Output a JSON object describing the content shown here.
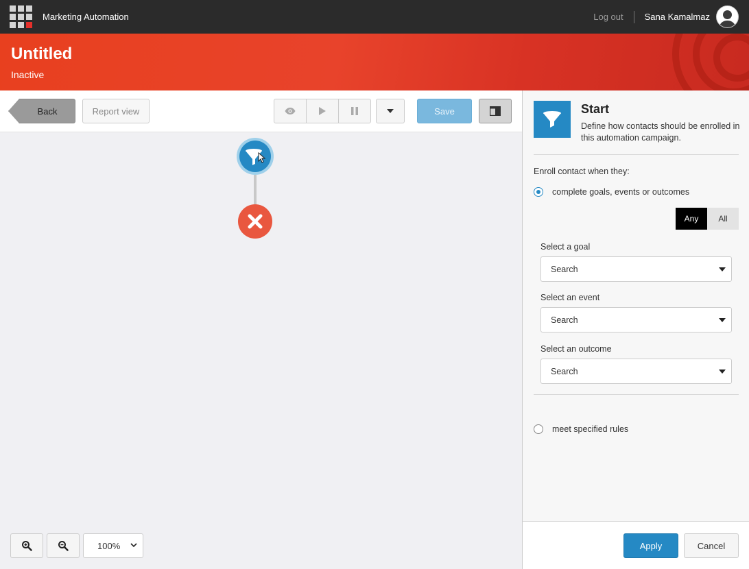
{
  "topbar": {
    "app_title": "Marketing Automation",
    "logout_label": "Log out",
    "user_name": "Sana Kamalmaz"
  },
  "header": {
    "title": "Untitled",
    "status": "Inactive"
  },
  "toolbar": {
    "back_label": "Back",
    "report_view_label": "Report view",
    "save_label": "Save",
    "icons": [
      "eye-icon",
      "play-icon",
      "pause-icon",
      "caret-down-icon",
      "layout-icon"
    ]
  },
  "canvas": {
    "zoom_value": "100%",
    "nodes": [
      "start-filter-node",
      "end-node"
    ]
  },
  "panel": {
    "title": "Start",
    "description": "Define how contacts should be enrolled in this automation campaign.",
    "enroll_label": "Enroll contact when they:",
    "option_goals": "complete goals, events or outcomes",
    "toggle_any": "Any",
    "toggle_all": "All",
    "goal_label": "Select a goal",
    "goal_value": "Search",
    "event_label": "Select an event",
    "event_value": "Search",
    "outcome_label": "Select an outcome",
    "outcome_value": "Search",
    "option_rules": "meet specified rules",
    "apply_label": "Apply",
    "cancel_label": "Cancel"
  },
  "colors": {
    "accent_blue": "#2589c4",
    "header_red": "#e8401f",
    "end_node_red": "#e9573f",
    "topbar_bg": "#2b2b2b"
  }
}
